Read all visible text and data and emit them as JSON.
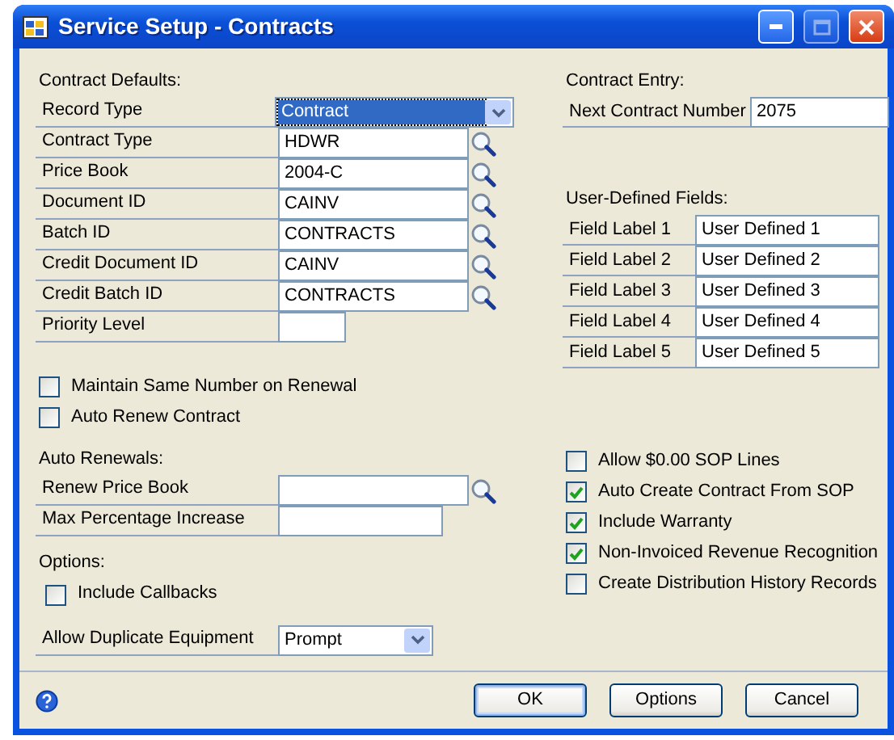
{
  "window": {
    "title": "Service Setup - Contracts"
  },
  "contract_defaults": {
    "heading": "Contract Defaults:",
    "fields": [
      {
        "label": "Record Type",
        "kind": "dropdown",
        "value": "Contract",
        "focused": true
      },
      {
        "label": "Contract Type",
        "kind": "lookup",
        "value": "HDWR",
        "focused": false
      },
      {
        "label": "Price Book",
        "kind": "lookup",
        "value": "2004-C",
        "focused": false
      },
      {
        "label": "Document ID",
        "kind": "lookup",
        "value": "CAINV",
        "focused": false
      },
      {
        "label": "Batch ID",
        "kind": "lookup",
        "value": "CONTRACTS",
        "focused": false
      },
      {
        "label": "Credit Document ID",
        "kind": "lookup",
        "value": "CAINV",
        "focused": false
      },
      {
        "label": "Credit Batch ID",
        "kind": "lookup",
        "value": "CONTRACTS",
        "focused": false
      },
      {
        "label": "Priority Level",
        "kind": "short",
        "focused": false
      }
    ]
  },
  "renewal_checkboxes": [
    {
      "label": "Maintain Same Number on Renewal",
      "checked": false
    },
    {
      "label": "Auto Renew Contract",
      "checked": false
    }
  ],
  "auto_renewals": {
    "heading": "Auto Renewals:",
    "fields": [
      {
        "label": "Renew Price Book",
        "kind": "lookup",
        "focused": false
      },
      {
        "label": "Max Percentage Increase",
        "kind": "text",
        "focused": false
      }
    ]
  },
  "options": {
    "heading": "Options:",
    "checkboxes": [
      {
        "label": "Include Callbacks",
        "checked": false
      }
    ],
    "fields": [
      {
        "label": "Allow Duplicate Equipment",
        "kind": "dropdown",
        "value": "Prompt",
        "focused": false
      }
    ]
  },
  "contract_entry": {
    "heading": "Contract Entry:",
    "label": "Next Contract Number",
    "value": "2075"
  },
  "user_defined_fields": {
    "heading": "User-Defined Fields:",
    "rows": [
      {
        "label": "Field Label 1",
        "value": "User Defined 1"
      },
      {
        "label": "Field Label 2",
        "value": "User Defined 2"
      },
      {
        "label": "Field Label 3",
        "value": "User Defined 3"
      },
      {
        "label": "Field Label 4",
        "value": "User Defined 4"
      },
      {
        "label": "Field Label 5",
        "value": "User Defined 5"
      }
    ]
  },
  "sop_checkboxes": [
    {
      "label": "Allow $0.00 SOP Lines",
      "checked": false
    },
    {
      "label": "Auto Create Contract From SOP",
      "checked": true
    },
    {
      "label": "Include Warranty",
      "checked": true
    },
    {
      "label": "Non-Invoiced Revenue Recognition",
      "checked": true
    },
    {
      "label": "Create Distribution History Records",
      "checked": false
    }
  ],
  "buttons": [
    {
      "label": "OK",
      "default": true
    },
    {
      "label": "Options",
      "default": false
    },
    {
      "label": "Cancel",
      "default": false
    }
  ]
}
